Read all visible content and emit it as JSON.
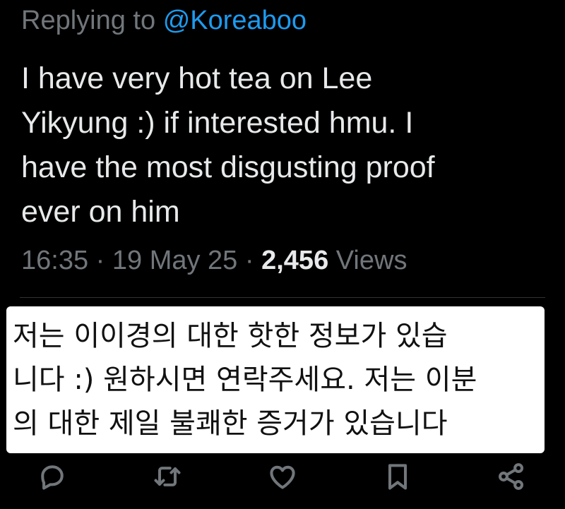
{
  "reply": {
    "prefix": "Replying to",
    "handle": "@Koreaboo"
  },
  "tweet": {
    "lines": [
      "I have very hot tea on Lee",
      "Yikyung :) if interested hmu. I",
      "have the most disgusting proof",
      "ever on him"
    ]
  },
  "meta": {
    "time": "16:35",
    "separator": "·",
    "date": "19 May 25",
    "views_count": "2,456",
    "views_label": "Views"
  },
  "translation": {
    "lines": [
      "저는 이이경의 대한 핫한 정보가 있습",
      "니다 :) 원하시면 연락주세요. 저는 이분",
      "의 대한 제일 불쾌한 증거가 있습니다"
    ]
  },
  "actions": {
    "icons": [
      "reply-icon",
      "retweet-icon",
      "like-icon",
      "bookmark-icon",
      "share-icon"
    ],
    "icon_color": "#71767b"
  },
  "colors": {
    "background": "#000000",
    "text": "#e7e9ea",
    "muted": "#71767b",
    "link": "#1d9bf0",
    "divider": "#2f3336",
    "translation_bg": "#ffffff",
    "translation_text": "#111111"
  }
}
